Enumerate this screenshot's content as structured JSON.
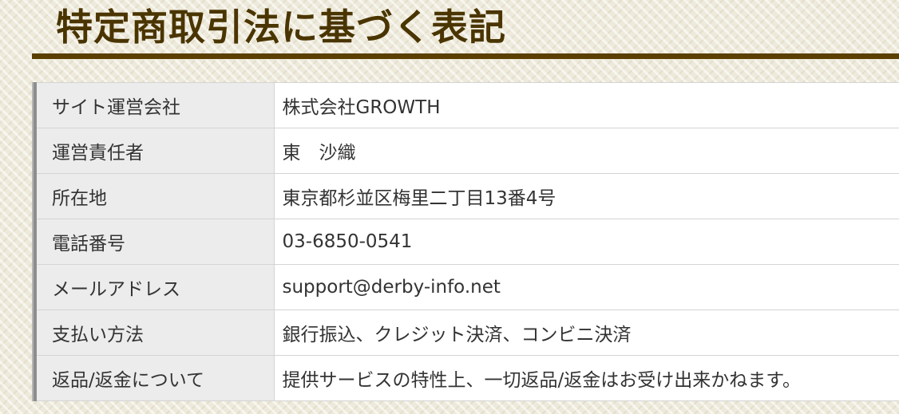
{
  "page": {
    "title": "特定商取引法に基づく表記"
  },
  "colors": {
    "title_text": "#4a3500",
    "title_rule": "#5b3f00",
    "header_cell_bg": "#ececec",
    "value_cell_bg": "#ffffff",
    "border": "#d4d4d4",
    "accent_bar": "#8d8d8d"
  },
  "table": {
    "rows": [
      {
        "label": "サイト運営会社",
        "value": "株式会社GROWTH"
      },
      {
        "label": "運営責任者",
        "value": "東　沙織"
      },
      {
        "label": "所在地",
        "value": "東京都杉並区梅里二丁目13番4号"
      },
      {
        "label": "電話番号",
        "value": "03-6850-0541"
      },
      {
        "label": "メールアドレス",
        "value": "support@derby-info.net"
      },
      {
        "label": "支払い方法",
        "value": "銀行振込、クレジット決済、コンビニ決済"
      },
      {
        "label": "返品/返金について",
        "value": "提供サービスの特性上、一切返品/返金はお受け出来かねます。"
      }
    ]
  }
}
